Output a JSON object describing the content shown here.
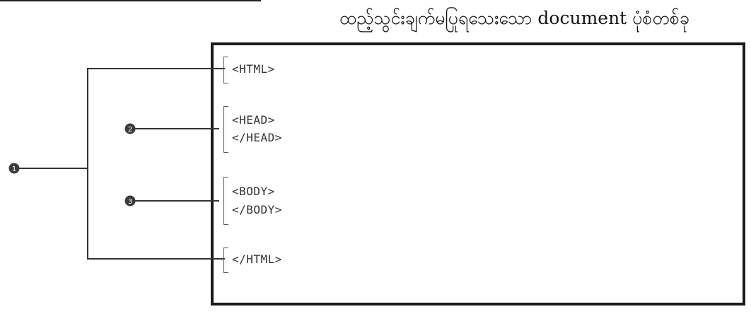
{
  "caption": "ထည့်သွင်းချက်မပြုရသေးသော  document ပုံစံတစ်ခု",
  "code_lines": {
    "html_open": "<HTML>",
    "head_open": "<HEAD>",
    "head_close": "</HEAD>",
    "body_open": "<BODY>",
    "body_close": "</BODY>",
    "html_close": "</HTML>"
  },
  "callouts": [
    "1",
    "2",
    "3"
  ],
  "colors": {
    "line": "#333333",
    "box_border": "#1a1a1a",
    "marker": "#3a3a3a"
  }
}
